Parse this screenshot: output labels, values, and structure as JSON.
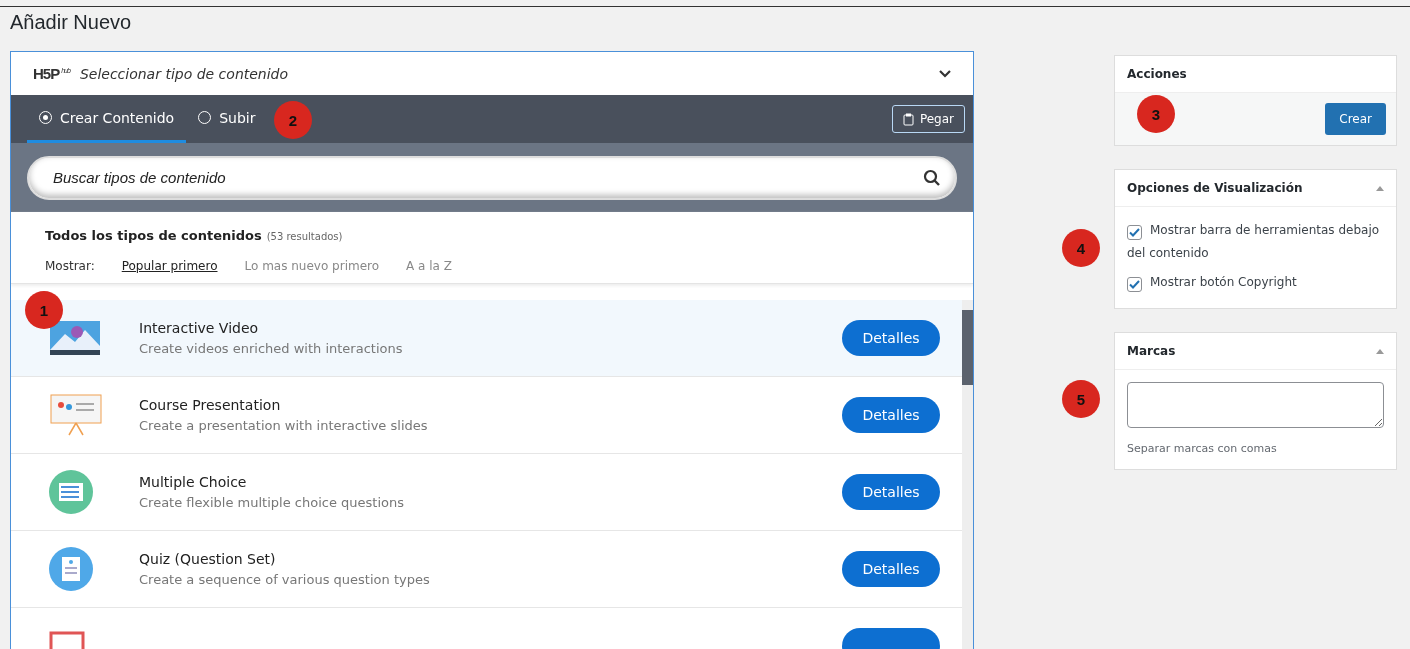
{
  "page_title": "Añadir Nuevo",
  "hub": {
    "logo": "H5P",
    "logo_sub": "hub",
    "title": "Seleccionar tipo de contenido",
    "expanded": true,
    "tabs": [
      {
        "label": "Crear Contenido",
        "selected": true
      },
      {
        "label": "Subir",
        "selected": false
      }
    ],
    "paste_button": "Pegar",
    "search": {
      "placeholder": "Buscar tipos de contenido"
    },
    "results": {
      "heading": "Todos los tipos de contenidos",
      "count": "(53 resultados)",
      "show_label": "Mostrar:",
      "sort_options": [
        {
          "label": "Popular primero",
          "selected": true
        },
        {
          "label": "Lo mas nuevo primero",
          "selected": false
        },
        {
          "label": "A a la Z",
          "selected": false
        }
      ]
    },
    "content_types": [
      {
        "title": "Interactive Video",
        "description": "Create videos enriched with interactions",
        "button": "Detalles",
        "selected": true
      },
      {
        "title": "Course Presentation",
        "description": "Create a presentation with interactive slides",
        "button": "Detalles",
        "selected": false
      },
      {
        "title": "Multiple Choice",
        "description": "Create flexible multiple choice questions",
        "button": "Detalles",
        "selected": false
      },
      {
        "title": "Quiz (Question Set)",
        "description": "Create a sequence of various question types",
        "button": "Detalles",
        "selected": false
      },
      {
        "selected": false
      }
    ]
  },
  "sidebar": {
    "actions": {
      "title": "Acciones",
      "button": "Crear"
    },
    "display_options": {
      "title": "Opciones de Visualización",
      "options": [
        {
          "label": "Mostrar barra de herramientas debajo del contenido",
          "checked": true
        },
        {
          "label": "Mostrar botón Copyright",
          "checked": true
        }
      ]
    },
    "tags": {
      "title": "Marcas",
      "hint": "Separar marcas con comas"
    }
  },
  "markers": [
    "1",
    "2",
    "3",
    "4",
    "5"
  ]
}
